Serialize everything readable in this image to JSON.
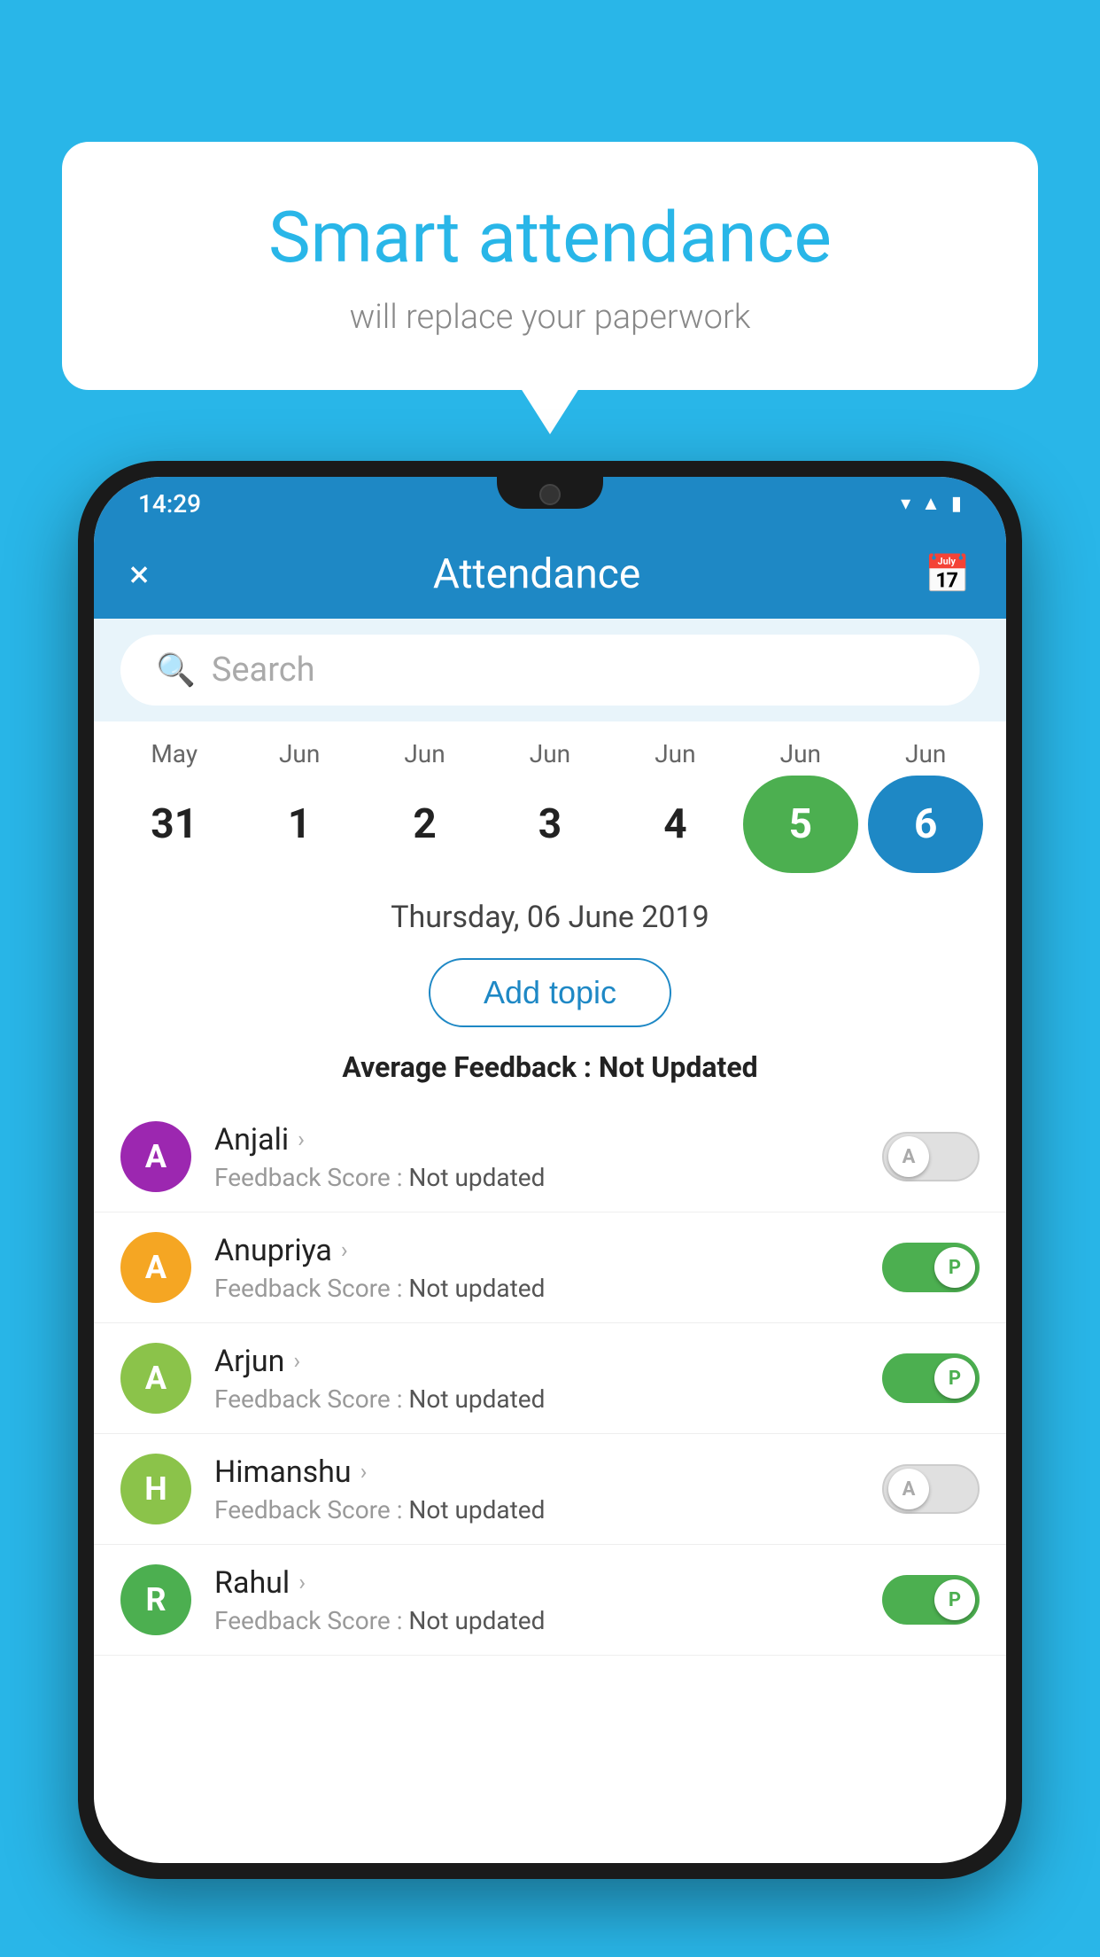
{
  "background_color": "#29b6e8",
  "bubble": {
    "title": "Smart attendance",
    "subtitle": "will replace your paperwork"
  },
  "status_bar": {
    "time": "14:29",
    "icons": [
      "wifi",
      "signal",
      "battery"
    ]
  },
  "top_bar": {
    "close_label": "×",
    "title": "Attendance",
    "calendar_icon": "📅"
  },
  "search": {
    "placeholder": "Search"
  },
  "calendar": {
    "months": [
      "May",
      "Jun",
      "Jun",
      "Jun",
      "Jun",
      "Jun",
      "Jun"
    ],
    "days": [
      "31",
      "1",
      "2",
      "3",
      "4",
      "5",
      "6"
    ],
    "today_index": 5,
    "selected_index": 6
  },
  "selected_date": "Thursday, 06 June 2019",
  "add_topic_label": "Add topic",
  "average_feedback": {
    "label": "Average Feedback : ",
    "value": "Not Updated"
  },
  "students": [
    {
      "name": "Anjali",
      "avatar_letter": "A",
      "avatar_color": "#9c27b0",
      "feedback_label": "Feedback Score : ",
      "feedback_value": "Not updated",
      "toggle_state": "off",
      "toggle_letter": "A"
    },
    {
      "name": "Anupriya",
      "avatar_letter": "A",
      "avatar_color": "#f5a623",
      "feedback_label": "Feedback Score : ",
      "feedback_value": "Not updated",
      "toggle_state": "on",
      "toggle_letter": "P"
    },
    {
      "name": "Arjun",
      "avatar_letter": "A",
      "avatar_color": "#8bc34a",
      "feedback_label": "Feedback Score : ",
      "feedback_value": "Not updated",
      "toggle_state": "on",
      "toggle_letter": "P"
    },
    {
      "name": "Himanshu",
      "avatar_letter": "H",
      "avatar_color": "#8bc34a",
      "feedback_label": "Feedback Score : ",
      "feedback_value": "Not updated",
      "toggle_state": "off",
      "toggle_letter": "A"
    },
    {
      "name": "Rahul",
      "avatar_letter": "R",
      "avatar_color": "#4caf50",
      "feedback_label": "Feedback Score : ",
      "feedback_value": "Not updated",
      "toggle_state": "on",
      "toggle_letter": "P"
    }
  ]
}
